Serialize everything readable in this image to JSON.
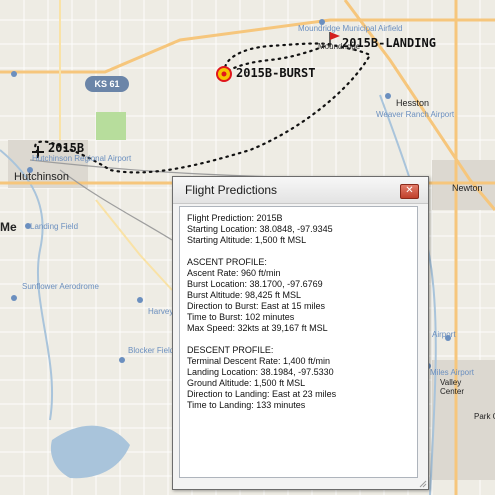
{
  "map": {
    "road_shield": "KS 61",
    "labels": {
      "moundridge_airfield": "Moundridge Municipal Airfield",
      "moundridge": "Moundridge",
      "hesston": "Hesston",
      "weaver_ranch": "Weaver Ranch Airport",
      "hutchinson_airport": "Hutchinson Regional Airport",
      "hutchinson": "Hutchinson",
      "landing_field": "Landing Field",
      "sunflower": "Sunflower Aerodrome",
      "harvey": "Harvey Airport",
      "blocker": "Blocker Field",
      "newton": "Newton",
      "me": "Me",
      "valley_center": "Valley Center",
      "park_city": "Park Cit",
      "miles_airport": "Miles Airport",
      "airport_right": "Airport"
    },
    "markers": {
      "launch": "2015B",
      "burst": "2015B-BURST",
      "landing": "2015B-LANDING"
    },
    "colors": {
      "path": "#111111",
      "burst_ring": "#e0161b",
      "burst_fill": "#f5c400",
      "landing_flag": "#d42020",
      "road_major": "#f6c67c",
      "water": "#a9c4db",
      "park": "#b7dd9c"
    }
  },
  "dialog": {
    "title": "Flight Predictions",
    "close_icon": "close-icon",
    "lines": [
      "Flight Prediction: 2015B",
      "Starting Location: 38.0848, -97.9345",
      "Starting Altitude: 1,500 ft MSL",
      "",
      "ASCENT PROFILE:",
      "Ascent Rate: 960 ft/min",
      "Burst Location: 38.1700, -97.6769",
      "Burst Altitude: 98,425 ft MSL",
      "Direction to Burst: East at 15 miles",
      "Time to Burst: 102 minutes",
      "Max Speed: 32kts at 39,167 ft MSL",
      "",
      "DESCENT PROFILE:",
      "Terminal Descent Rate: 1,400 ft/min",
      "Landing Location: 38.1984, -97.5330",
      "Ground Altitude: 1,500 ft MSL",
      "Direction to Landing: East at 23 miles",
      "Time to Landing: 133 minutes"
    ]
  }
}
